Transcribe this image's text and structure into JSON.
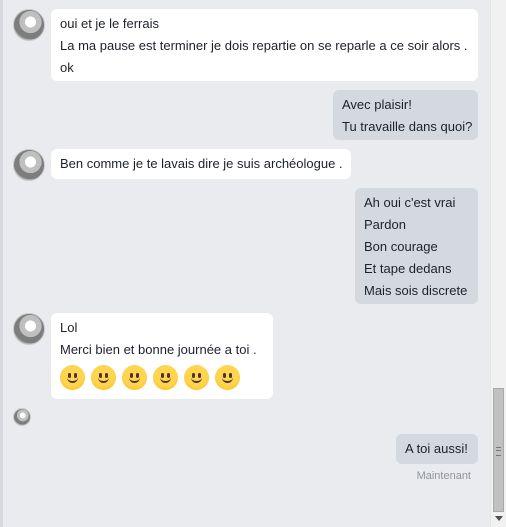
{
  "messages": [
    {
      "sender": "contact",
      "lines": [
        "oui et je le ferrais",
        "La ma pause est terminer je dois repartie on se reparle a ce soir alors .",
        "ok"
      ]
    },
    {
      "sender": "me",
      "lines": [
        "Avec plaisir!",
        "Tu travaille dans quoi?"
      ]
    },
    {
      "sender": "contact",
      "lines": [
        "Ben comme je te lavais dire je suis archéologue ."
      ]
    },
    {
      "sender": "me",
      "lines": [
        "Ah oui c'est vrai",
        "Pardon",
        "Bon courage",
        "Et tape dedans",
        "Mais sois discrete"
      ]
    },
    {
      "sender": "contact",
      "lines": [
        "Lol",
        "Merci  bien et  bonne journée a toi ."
      ],
      "emoji": [
        "smiling-face",
        "smiling-face",
        "smiling-face",
        "smiling-face",
        "smiling-face",
        "smiling-face"
      ]
    },
    {
      "sender": "me",
      "lines": [
        "A toi aussi!"
      ]
    }
  ],
  "status": {
    "timestamp": "Maintenant"
  },
  "colors": {
    "background": "#e9ebee",
    "incoming_bubble": "#ffffff",
    "outgoing_bubble": "#d4d9e0"
  },
  "icons": {
    "contact_avatar": "avatar",
    "emoji": "slightly-smiling-face"
  }
}
